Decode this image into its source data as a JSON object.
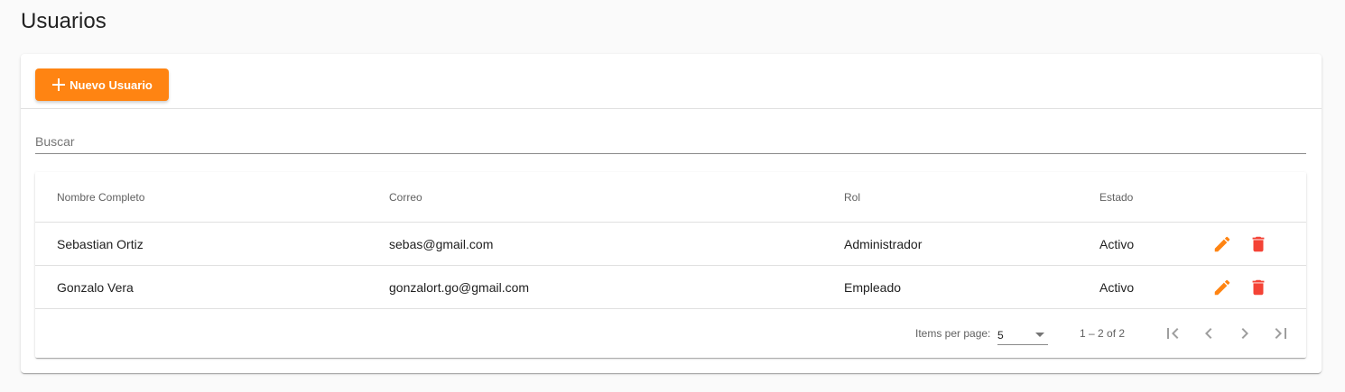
{
  "page": {
    "title": "Usuarios"
  },
  "toolbar": {
    "new_user_label": "Nuevo Usuario",
    "accent_color": "#ff8412"
  },
  "search": {
    "placeholder": "Buscar",
    "value": ""
  },
  "table": {
    "columns": [
      "Nombre Completo",
      "Correo",
      "Rol",
      "Estado"
    ],
    "rows": [
      {
        "name": "Sebastian Ortiz",
        "email": "sebas@gmail.com",
        "role": "Administrador",
        "status": "Activo"
      },
      {
        "name": "Gonzalo Vera",
        "email": "gonzalort.go@gmail.com",
        "role": "Empleado",
        "status": "Activo"
      }
    ],
    "row_actions": [
      {
        "icon": "edit-icon",
        "color": "#ff8412"
      },
      {
        "icon": "delete-icon",
        "color": "#f44336"
      }
    ]
  },
  "paginator": {
    "items_per_page_label": "Items per page:",
    "page_size": "5",
    "range_label": "1 – 2 of 2",
    "nav_icons": [
      "first-page-icon",
      "previous-page-icon",
      "next-page-icon",
      "last-page-icon"
    ]
  }
}
